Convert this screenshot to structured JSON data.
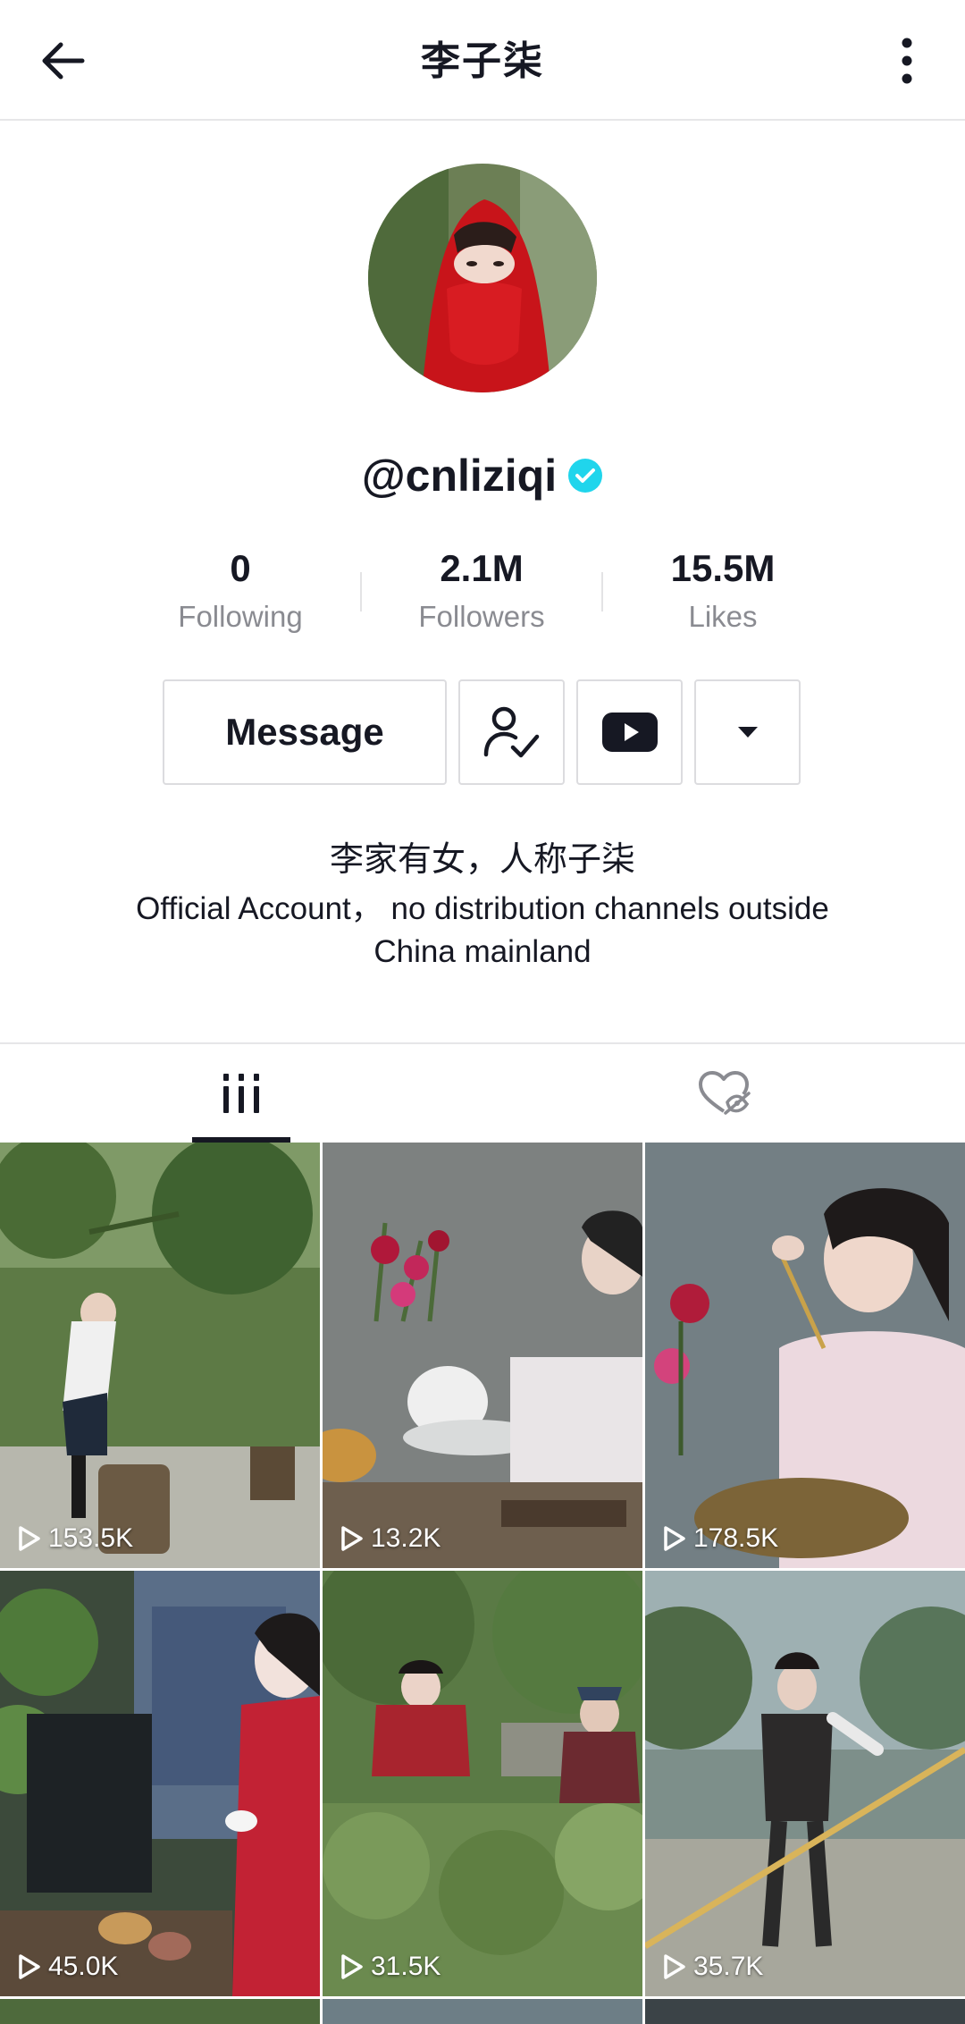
{
  "header": {
    "title": "李子柒",
    "back_icon": "back-arrow-icon",
    "more_icon": "vertical-dots-icon"
  },
  "profile": {
    "username": "@cnliziqi",
    "verified_icon": "verified-badge-icon",
    "verified_color": "#20d5ec"
  },
  "stats": [
    {
      "value": "0",
      "label": "Following"
    },
    {
      "value": "2.1M",
      "label": "Followers"
    },
    {
      "value": "15.5M",
      "label": "Likes"
    }
  ],
  "actions": {
    "message_label": "Message",
    "following_icon": "person-check-icon",
    "youtube_icon": "youtube-icon",
    "dropdown_icon": "caret-down-icon"
  },
  "bio": {
    "line1": "李家有女，人称子柒",
    "line2": "Official Account， no distribution channels outside China mainland"
  },
  "tabs": [
    {
      "name": "videos",
      "icon": "grid-bars-icon",
      "active": true
    },
    {
      "name": "liked",
      "icon": "hidden-heart-icon",
      "active": false
    }
  ],
  "videos": [
    {
      "views": "153.5K"
    },
    {
      "views": "13.2K"
    },
    {
      "views": "178.5K"
    },
    {
      "views": "45.0K"
    },
    {
      "views": "31.5K"
    },
    {
      "views": "35.7K"
    }
  ]
}
